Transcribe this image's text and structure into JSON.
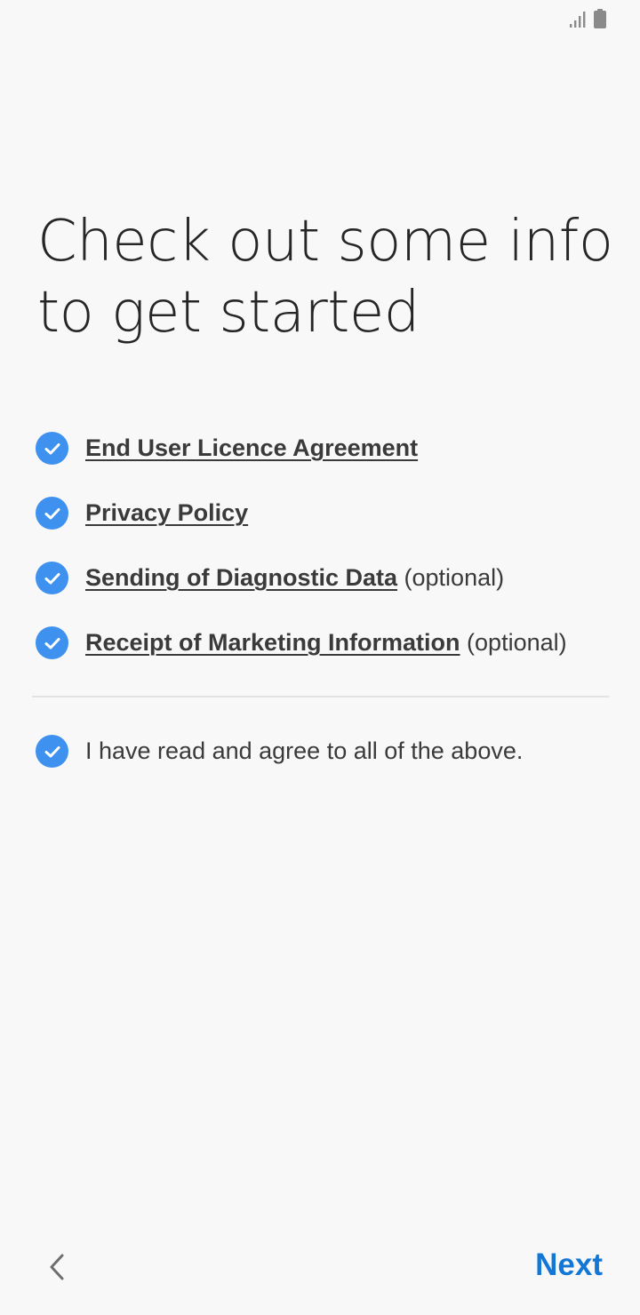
{
  "status_bar": {
    "icons": [
      "signal-icon",
      "battery-icon"
    ]
  },
  "title": "Check out some info to get started",
  "items": [
    {
      "link": "End User Licence Agreement",
      "suffix": "",
      "checked": true
    },
    {
      "link": "Privacy Policy",
      "suffix": "",
      "checked": true
    },
    {
      "link": "Sending of Diagnostic Data",
      "suffix": " (optional)",
      "checked": true
    },
    {
      "link": "Receipt of Marketing Information",
      "suffix": " (optional)",
      "checked": true
    }
  ],
  "agree_all": {
    "label": "I have read and agree to all of the above.",
    "checked": true
  },
  "nav": {
    "back_icon": "chevron-left-icon",
    "next_label": "Next"
  },
  "colors": {
    "accent": "#3e91ef",
    "next": "#1277d5",
    "background": "#f8f8f8"
  }
}
